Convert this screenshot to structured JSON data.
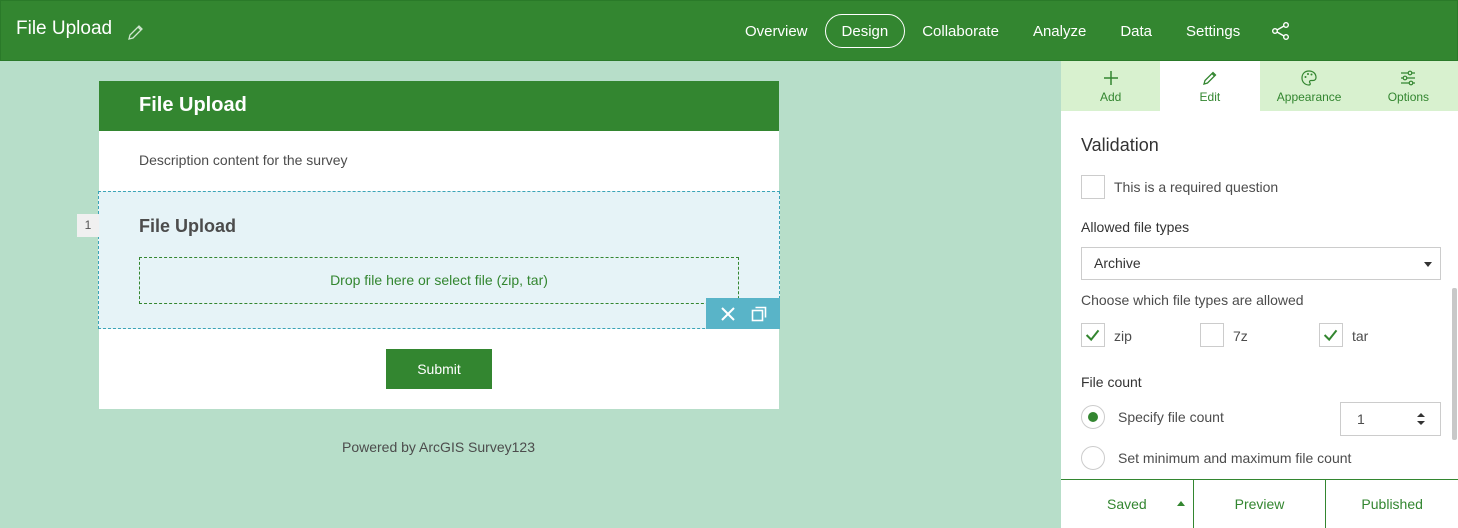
{
  "header": {
    "title": "File Upload",
    "nav": [
      "Overview",
      "Design",
      "Collaborate",
      "Analyze",
      "Data",
      "Settings"
    ],
    "active_nav": "Design"
  },
  "survey": {
    "title": "File Upload",
    "description": "Description content for the survey",
    "question": {
      "number": "1",
      "title": "File Upload",
      "dropzone": "Drop file here or select file (zip, tar)"
    },
    "submit_label": "Submit",
    "powered_by": "Powered by ArcGIS Survey123"
  },
  "panel": {
    "tabs": [
      {
        "label": "Add",
        "icon": "plus-icon"
      },
      {
        "label": "Edit",
        "icon": "pencil-icon"
      },
      {
        "label": "Appearance",
        "icon": "palette-icon"
      },
      {
        "label": "Options",
        "icon": "sliders-icon"
      }
    ],
    "active_tab": "Edit",
    "validation_title": "Validation",
    "required_label": "This is a required question",
    "required_checked": false,
    "allowed_types_label": "Allowed file types",
    "allowed_types_value": "Archive",
    "choose_types_label": "Choose which file types are allowed",
    "file_types": [
      {
        "label": "zip",
        "checked": true
      },
      {
        "label": "7z",
        "checked": false
      },
      {
        "label": "tar",
        "checked": true
      }
    ],
    "file_count_label": "File count",
    "specify_count_label": "Specify file count",
    "specify_count_selected": true,
    "file_count_value": "1",
    "min_max_label": "Set minimum and maximum file count",
    "footer": {
      "saved": "Saved",
      "preview": "Preview",
      "published": "Published"
    }
  },
  "colors": {
    "brand_green": "#338630",
    "background": "#b7dec9",
    "question_bg": "#e6f3f7",
    "tool_blue": "#59b4c8"
  }
}
